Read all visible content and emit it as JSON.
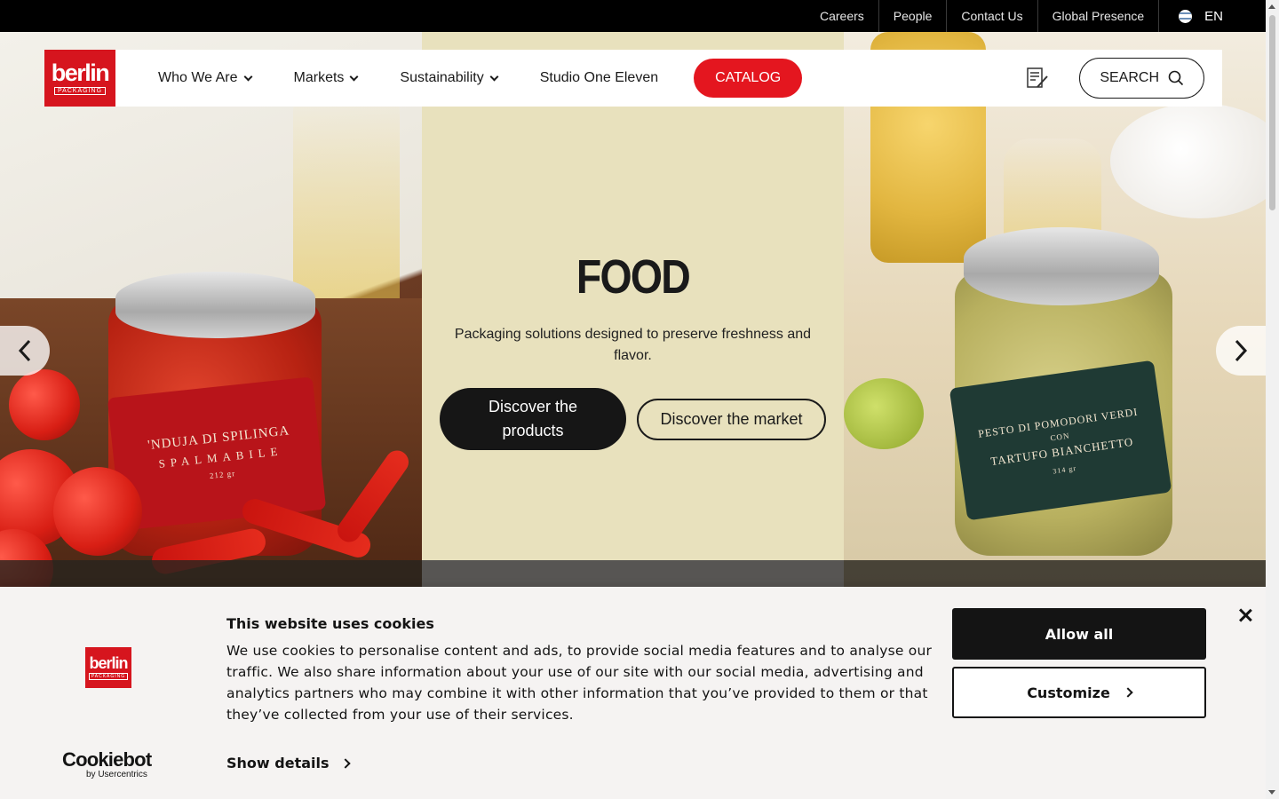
{
  "utility_nav": {
    "links": [
      "Careers",
      "People",
      "Contact Us",
      "Global Presence"
    ],
    "language": "EN"
  },
  "main_nav": {
    "logo_word": "berlin",
    "logo_sub": "PACKAGING",
    "items": [
      {
        "label": "Who We Are",
        "has_dropdown": true
      },
      {
        "label": "Markets",
        "has_dropdown": true
      },
      {
        "label": "Sustainability",
        "has_dropdown": true
      },
      {
        "label": "Studio One Eleven",
        "has_dropdown": false
      }
    ],
    "catalog_label": "CATALOG",
    "search_label": "SEARCH",
    "catalog_color": "#e4161f"
  },
  "hero": {
    "title": "FOOD",
    "description": "Packaging solutions designed to preserve freshness and flavor.",
    "primary_cta": "Discover the products",
    "secondary_cta": "Discover the market",
    "left_jar_label_line1": "'NDUJA DI SPILINGA",
    "left_jar_label_line2": "SPALMABILE",
    "left_jar_weight": "212 gr",
    "right_jar_label_line1": "PESTO DI POMODORI VERDI",
    "right_jar_label_line2": "CON",
    "right_jar_label_line3": "TARTUFO BIANCHETTO",
    "right_jar_weight": "314 gr",
    "center_bg": "#e8e1bd"
  },
  "cookie_banner": {
    "title": "This website uses cookies",
    "text": "We use cookies to personalise content and ads, to provide social media features and to analyse our traffic. We also share information about your use of our site with our social media, advertising and analytics partners who may combine it with other information that you’ve provided to them or that they’ve collected from your use of their services.",
    "show_details": "Show details",
    "allow_all": "Allow all",
    "customize": "Customize",
    "provider_name": "Cookiebot",
    "provider_by": "by Usercentrics"
  }
}
